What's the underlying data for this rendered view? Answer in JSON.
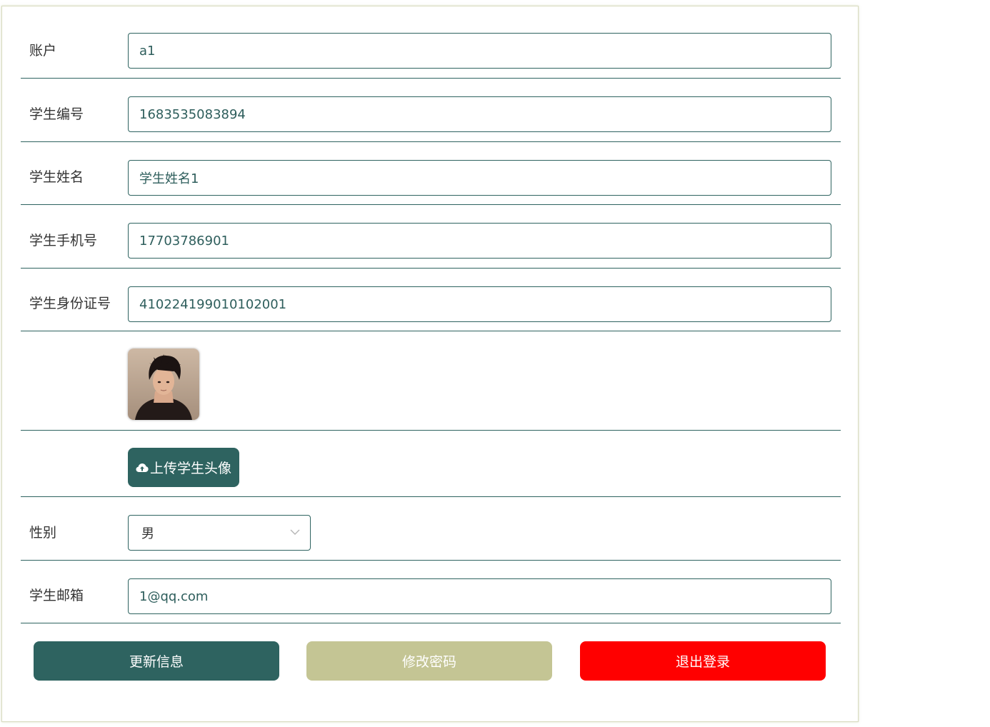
{
  "form": {
    "account": {
      "label": "账户",
      "value": "a1"
    },
    "student_no": {
      "label": "学生编号",
      "value": "1683535083894"
    },
    "student_name": {
      "label": "学生姓名",
      "value": "学生姓名1"
    },
    "student_phone": {
      "label": "学生手机号",
      "value": "17703786901"
    },
    "student_id_card": {
      "label": "学生身份证号",
      "value": "410224199010102001"
    },
    "avatar": {
      "icon": "person-photo"
    },
    "upload": {
      "label": "上传学生头像",
      "icon": "cloud-upload-icon"
    },
    "gender": {
      "label": "性别",
      "value": "男"
    },
    "student_email": {
      "label": "学生邮箱",
      "value": "1@qq.com"
    }
  },
  "actions": {
    "update": {
      "label": "更新信息",
      "color": "#2e6360"
    },
    "change_password": {
      "label": "修改密码",
      "color": "#c4c594"
    },
    "logout": {
      "label": "退出登录",
      "color": "#ff0000"
    }
  },
  "colors": {
    "accent": "#2e6360",
    "border": "#2e6360",
    "panel_border": "#d9dcc0"
  }
}
